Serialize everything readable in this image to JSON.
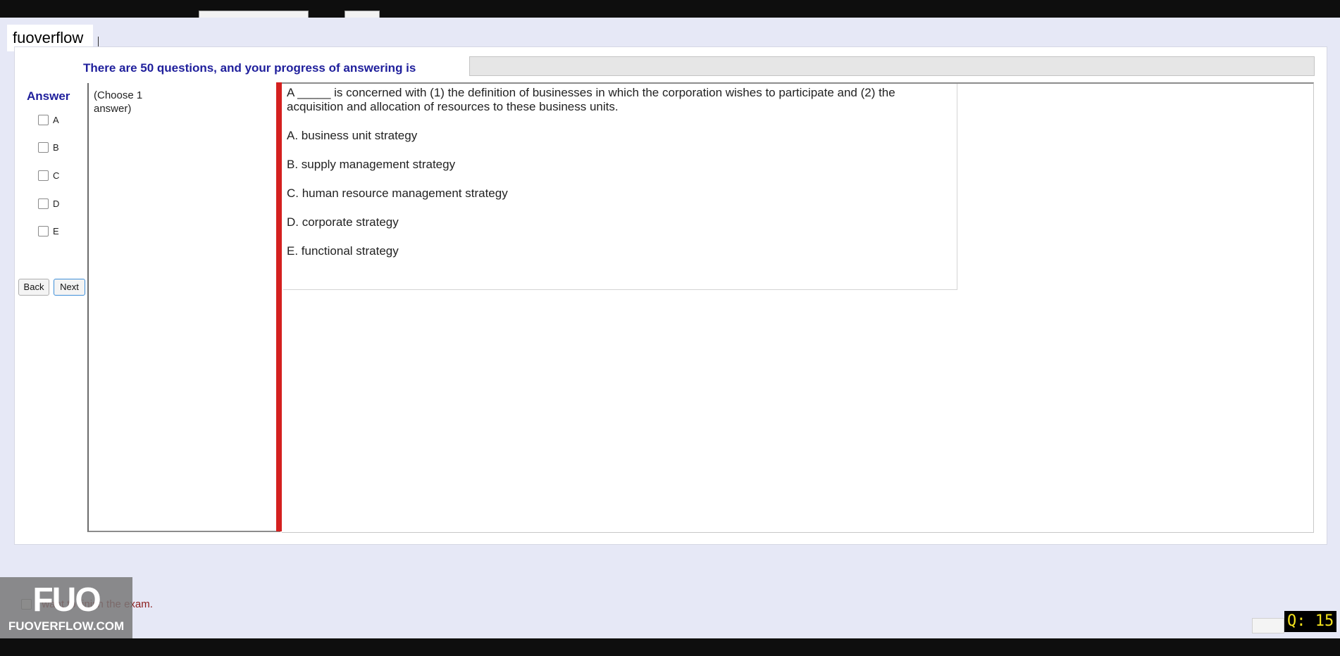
{
  "window": {
    "tab_label": "fuoverflow"
  },
  "header": {
    "progress_label": "There are 50 questions, and your progress of answering is",
    "progress_fraction": 0
  },
  "answer_panel": {
    "title": "Answer",
    "options": [
      "A",
      "B",
      "C",
      "D",
      "E"
    ],
    "back_label": "Back",
    "next_label": "Next"
  },
  "instruction": "(Choose 1 answer)",
  "question": {
    "text": "A _____ is concerned with (1) the definition of businesses in which the corporation wishes to participate and (2) the acquisition and allocation of resources to these business units.",
    "choices": [
      "A.  business unit strategy",
      "B.  supply management strategy",
      "C.  human resource management strategy",
      "D.  corporate strategy",
      "E.  functional strategy"
    ]
  },
  "footer": {
    "finish_label": "I want to finish the exam.",
    "question_counter": "Q: 15"
  },
  "watermark": {
    "mark": "FUO",
    "site": "FUOVERFLOW.COM"
  },
  "colors": {
    "accent_blue": "#1f1f9c",
    "divider_red": "#d4201f",
    "counter_yellow": "#f3e21d"
  }
}
